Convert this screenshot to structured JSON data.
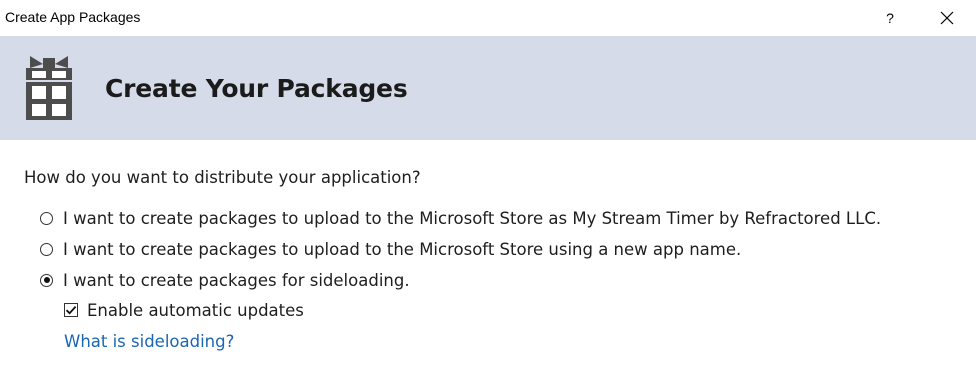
{
  "window": {
    "title": "Create App Packages",
    "help_label": "?",
    "close_icon": "close-icon"
  },
  "header": {
    "title": "Create Your Packages",
    "icon": "gift-package-icon",
    "band_color": "#d5dbe8"
  },
  "content": {
    "question": "How do you want to distribute your application?",
    "options": [
      {
        "label": "I want to create packages to upload to the Microsoft Store as My Stream Timer by Refractored LLC.",
        "selected": false
      },
      {
        "label": "I want to create packages to upload to the Microsoft Store using a new app name.",
        "selected": false
      },
      {
        "label": "I want to create packages for sideloading.",
        "selected": true
      }
    ],
    "auto_updates": {
      "label": "Enable automatic updates",
      "checked": true
    },
    "help_link": {
      "label": "What is sideloading?",
      "color": "#1a66b3"
    }
  }
}
